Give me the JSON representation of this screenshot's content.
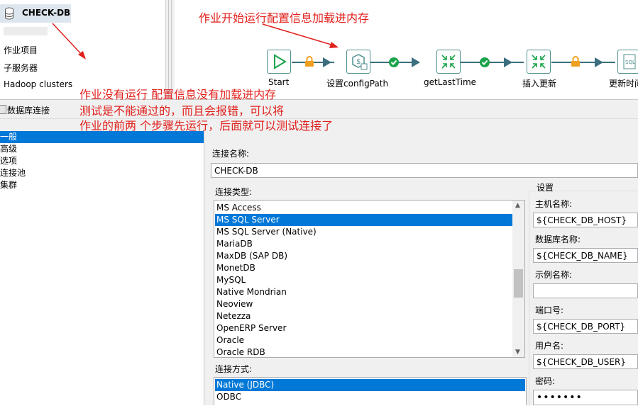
{
  "repo": {
    "db_name": "CHECK-DB",
    "items": [
      "作业项目",
      "子服务器",
      "Hadoop clusters"
    ]
  },
  "job": {
    "steps": [
      {
        "label": "Start"
      },
      {
        "label": "设置configPath"
      },
      {
        "label": "getLastTime"
      },
      {
        "label": "插入更新"
      },
      {
        "label": "更新时间"
      }
    ]
  },
  "annotations": {
    "top": "作业开始运行配置信息加载进内存",
    "lines": [
      "作业没有运行 配置信息没有加载进内存",
      "测试是不能通过的，而且会报错，可以将",
      "作业的前两 个步骤先运行，后面就可以测试连接了"
    ],
    "color": "#e0201c"
  },
  "dialog": {
    "title": "数据库连接",
    "nav": [
      "一般",
      "高级",
      "选项",
      "连接池",
      "集群"
    ],
    "nav_selected": 0,
    "conn_name_label": "连接名称:",
    "conn_name_value": "CHECK-DB",
    "conn_type_label": "连接类型:",
    "conn_types": [
      "MS Access",
      "MS SQL Server",
      "MS SQL Server (Native)",
      "MariaDB",
      "MaxDB (SAP DB)",
      "MonetDB",
      "MySQL",
      "Native Mondrian",
      "Neoview",
      "Netezza",
      "OpenERP Server",
      "Oracle",
      "Oracle RDB"
    ],
    "conn_type_selected": 1,
    "access_label": "连接方式:",
    "access_types": [
      "Native (JDBC)",
      "ODBC"
    ],
    "access_selected": 0,
    "settings": {
      "group_label": "设置",
      "host_label": "主机名称:",
      "host_value": "${CHECK_DB_HOST}",
      "dbname_label": "数据库名称:",
      "dbname_value": "${CHECK_DB_NAME}",
      "instance_label": "示例名称:",
      "instance_value": "",
      "port_label": "端口号:",
      "port_value": "${CHECK_DB_PORT}",
      "user_label": "用户名:",
      "user_value": "${CHECK_DB_USER}",
      "password_label": "密码:",
      "password_value": "•••••••"
    },
    "accent": "#0078d7"
  }
}
